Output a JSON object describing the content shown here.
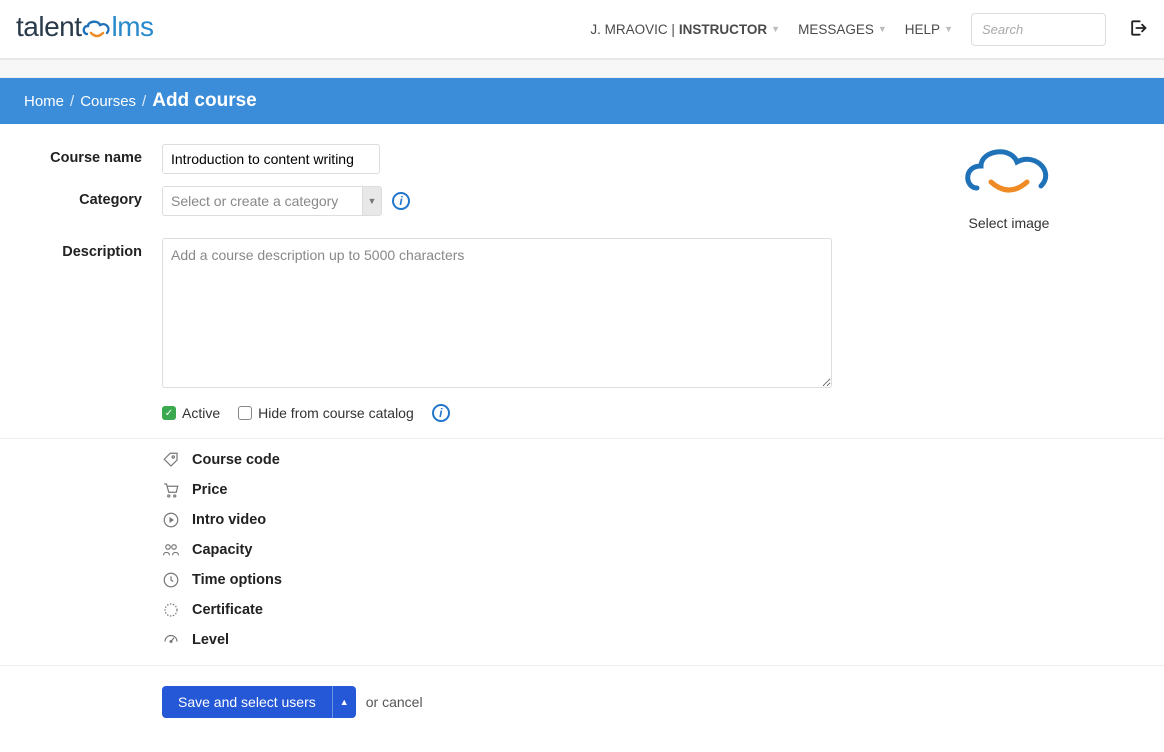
{
  "header": {
    "logo_part1": "talent",
    "logo_part2": "lms",
    "user_label": "J. MRAOVIC | ",
    "role_label": "INSTRUCTOR",
    "messages_label": "MESSAGES",
    "help_label": "HELP",
    "search_placeholder": "Search"
  },
  "breadcrumb": {
    "home": "Home",
    "courses": "Courses",
    "current": "Add course"
  },
  "form": {
    "course_name_label": "Course name",
    "course_name_value": "Introduction to content writing",
    "category_label": "Category",
    "category_placeholder": "Select or create a category",
    "description_label": "Description",
    "description_placeholder": "Add a course description up to 5000 characters",
    "active_label": "Active",
    "hide_label": "Hide from course catalog",
    "select_image_label": "Select image"
  },
  "options": [
    {
      "label": "Course code",
      "icon": "tag-icon"
    },
    {
      "label": "Price",
      "icon": "cart-icon"
    },
    {
      "label": "Intro video",
      "icon": "play-icon"
    },
    {
      "label": "Capacity",
      "icon": "capacity-icon"
    },
    {
      "label": "Time options",
      "icon": "clock-icon"
    },
    {
      "label": "Certificate",
      "icon": "certificate-icon"
    },
    {
      "label": "Level",
      "icon": "level-icon"
    }
  ],
  "actions": {
    "save_label": "Save and select users",
    "or_label": "or ",
    "cancel_label": "cancel"
  }
}
